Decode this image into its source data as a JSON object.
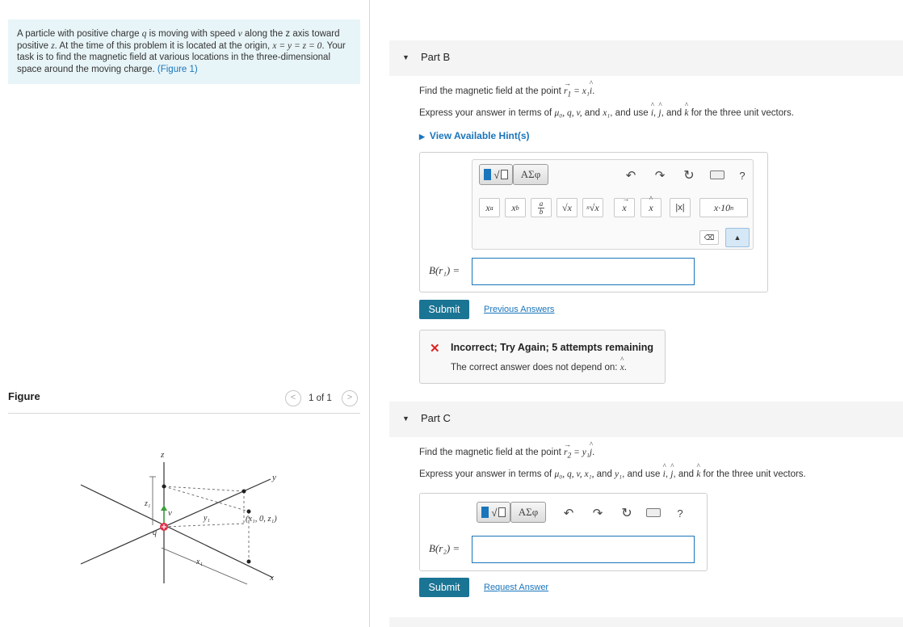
{
  "intro": {
    "text_1": "A particle with positive charge ",
    "q": "q",
    "text_2": " is moving with speed ",
    "v": "v",
    "text_3": " along the z axis toward positive ",
    "z": "z",
    "text_4": ". At the time of this problem it is located at the origin, ",
    "origin_eq": "x = y = z = 0",
    "text_5": ". Your task is to find the magnetic field at various locations in the three-dimensional space around the moving charge. ",
    "figure_link": "(Figure 1)"
  },
  "figure_panel": {
    "title": "Figure",
    "counter": "1 of 1",
    "prev_icon": "<",
    "next_icon": ">",
    "labels": {
      "z": "z",
      "y": "y",
      "x": "x",
      "z1": "z₁",
      "y1": "y₁",
      "x1": "x₁",
      "v": "v",
      "q": "q",
      "point": "(x₁, 0, z₁)"
    }
  },
  "part_b": {
    "title": "Part B",
    "find_prefix": "Find the magnetic field at the point ",
    "find_eq_lhs": "r",
    "find_eq_sub": "1",
    "find_eq_rhs": "= x₁",
    "find_eq_unit": "i",
    "express_prefix": "Express your answer in terms of ",
    "express_vars": "μ₀, q, v,",
    "express_and": " and ",
    "express_var_last": "x₁",
    "express_mid": ", and use ",
    "unit_i": "i",
    "unit_j": "j",
    "express_and2": ", and ",
    "unit_k": "k",
    "express_suffix": " for the three unit vectors.",
    "hint": "View Available Hint(s)",
    "toolbar_sqrt": "√",
    "toolbar_greek": "ΑΣφ",
    "toolbar_help": "?",
    "templates": [
      "xᵃ",
      "xb",
      "a/b",
      "√x",
      "ⁿ√x",
      "x⃗",
      "x̂",
      "|x|",
      "x·10ⁿ"
    ],
    "input_label": "B(r₁) =",
    "submit": "Submit",
    "previous_answers": "Previous Answers",
    "feedback_title": "Incorrect; Try Again; 5 attempts remaining",
    "feedback_detail_prefix": "The correct answer does not depend on: ",
    "feedback_detail_var": "x",
    "feedback_detail_suffix": "."
  },
  "part_c": {
    "title": "Part C",
    "find_prefix": "Find the magnetic field at the point ",
    "find_eq_lhs": "r",
    "find_eq_sub": "2",
    "find_eq_rhs": "= y₁",
    "find_eq_unit": "j",
    "express_prefix": "Express your answer in terms of ",
    "express_vars": "μ₀, q, v, x₁,",
    "express_and": " and ",
    "express_var_last": "y₁",
    "express_mid": ", and use ",
    "unit_i": "i",
    "unit_j": "j",
    "express_and2": ", and ",
    "unit_k": "k",
    "express_suffix": " for the three unit vectors.",
    "toolbar_sqrt": "√",
    "toolbar_greek": "ΑΣφ",
    "toolbar_help": "?",
    "input_label": "B(r₂) =",
    "submit": "Submit",
    "request_answer": "Request Answer"
  },
  "colors": {
    "accent": "#1a7494",
    "link": "#1a75bb",
    "intro_bg": "#e8f5f8",
    "error": "#dd2222",
    "charge": "#e0304a",
    "velocity": "#3a9e3a"
  }
}
